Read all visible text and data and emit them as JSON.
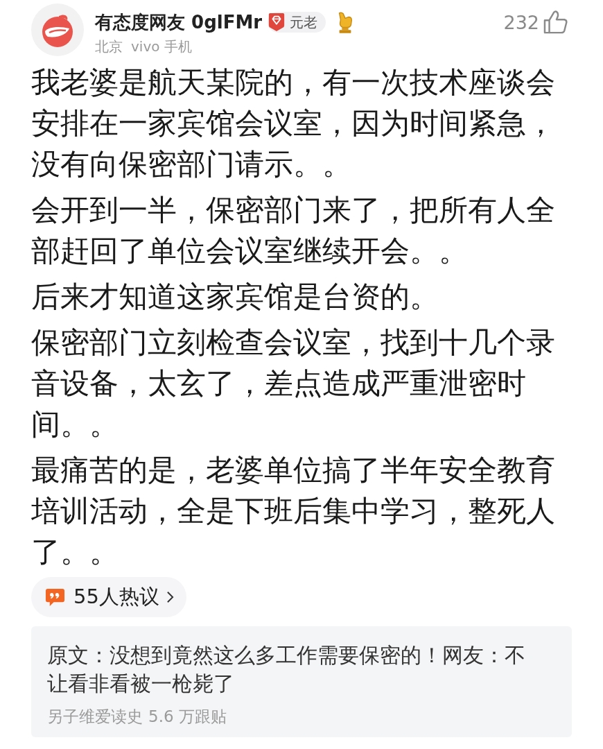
{
  "post": {
    "author": {
      "name": "有态度网友 0glFMr",
      "badge": "元老",
      "location": "北京",
      "device": "vivo 手机"
    },
    "likes": "232",
    "paragraphs": [
      "我老婆是航天某院的，有一次技术座谈会安排在一家宾馆会议室，因为时间紧急，没有向保密部门请示。。",
      "会开到一半，保密部门来了，把所有人全部赶回了单位会议室继续开会。。",
      "后来才知道这家宾馆是台资的。",
      "保密部门立刻检查会议室，找到十几个录音设备，太玄了，差点造成严重泄密时间。。",
      "最痛苦的是，老婆单位搞了半年安全教育培训活动，全是下班后集中学习，整死人了。。"
    ],
    "comments": {
      "label": "55人热议"
    },
    "source": {
      "quote": "原文：没想到竟然这么多工作需要保密的！网友：不让看非看被一枪毙了",
      "publisher": "另子维爱读史",
      "followups": "5.6 万跟贴"
    }
  }
}
